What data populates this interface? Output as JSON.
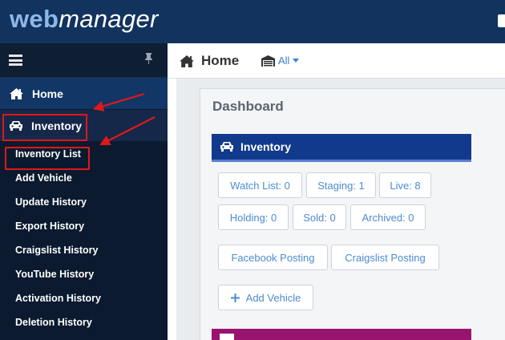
{
  "app": {
    "logo_web": "web",
    "logo_manager": "manager"
  },
  "sidebar": {
    "items": [
      {
        "label": "Home",
        "icon": "home-icon"
      },
      {
        "label": "Inventory",
        "icon": "car-icon"
      }
    ],
    "sub_items": [
      {
        "label": "Inventory List"
      },
      {
        "label": "Add Vehicle"
      },
      {
        "label": "Update History"
      },
      {
        "label": "Export History"
      },
      {
        "label": "Craigslist History"
      },
      {
        "label": "YouTube History"
      },
      {
        "label": "Activation History"
      },
      {
        "label": "Deletion History"
      }
    ]
  },
  "header": {
    "home_label": "Home",
    "filter_label": "All"
  },
  "dashboard": {
    "title": "Dashboard",
    "inventory": {
      "title": "Inventory",
      "stats": {
        "watch_list": "Watch List: 0",
        "staging": "Staging: 1",
        "live": "Live: 8",
        "holding": "Holding: 0",
        "sold": "Sold: 0",
        "archived": "Archived: 0"
      },
      "facebook_posting": "Facebook Posting",
      "craigslist_posting": "Craigslist Posting",
      "add_vehicle": "Add Vehicle"
    }
  },
  "colors": {
    "topbar": "#12335e",
    "sidebar": "#0b1a2e",
    "nav_item": "#123665",
    "inventory_header": "#123a8c",
    "link_blue": "#4d8bd0",
    "annotation_red": "#e0181b",
    "bottom_card": "#99146f"
  }
}
